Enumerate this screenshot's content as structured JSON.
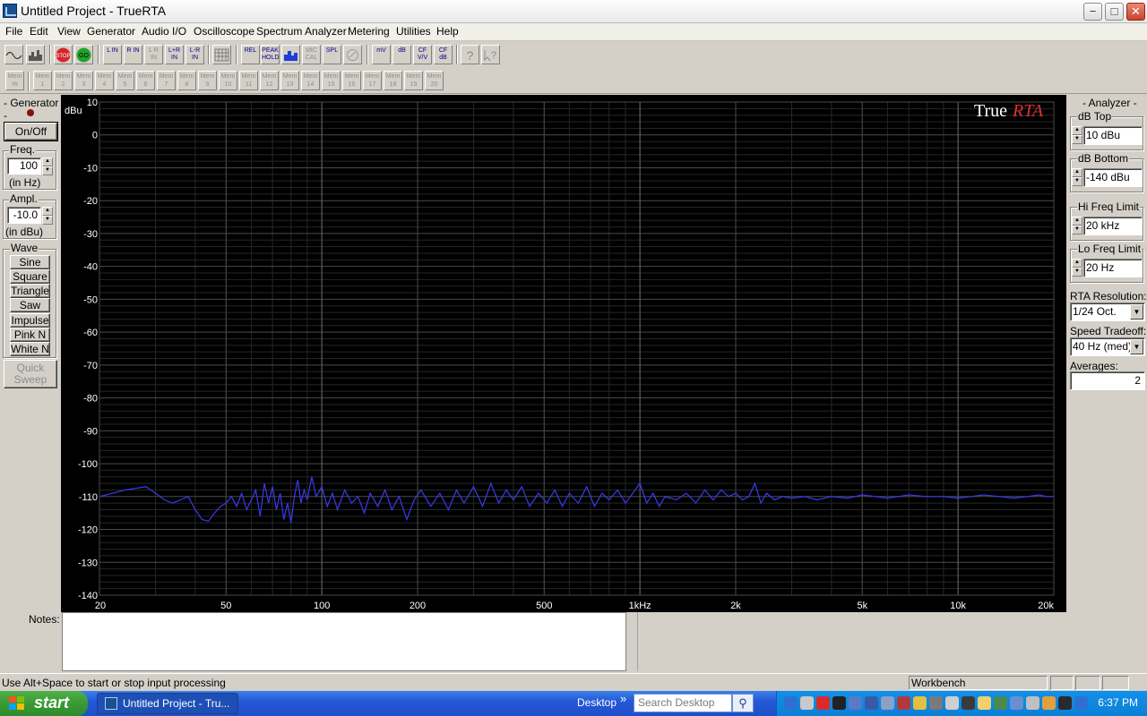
{
  "window": {
    "title": "Untitled Project - TrueRTA",
    "minimize": "−",
    "maximize": "□",
    "close": "✕"
  },
  "menu": [
    "File",
    "Edit",
    "View",
    "Generator",
    "Audio I/O",
    "Oscilloscope",
    "Spectrum Analyzer",
    "Metering",
    "Utilities",
    "Help"
  ],
  "toolbar": {
    "stop": "STOP",
    "go": "GO",
    "l_in": "L IN",
    "r_in": "R IN",
    "lr_in": "L R IN",
    "lplusr_in": "L+R IN",
    "lminusr_in": "L-R IN",
    "rel": "REL",
    "peak_hold": "PEAK HOLD",
    "mic_cal": "MIC CAL",
    "spl": "SPL",
    "mv": "mV",
    "db": "dB",
    "cf_vv": "CF V/V",
    "cf_db": "CF dB"
  },
  "memory": {
    "mem_w": "Mem W",
    "slots": [
      "Mem 1",
      "Mem 2",
      "Mem 3",
      "Mem 4",
      "Mem 5",
      "Mem 6",
      "Mem 7",
      "Mem 8",
      "Mem 9",
      "Mem 10",
      "Mem 11",
      "Mem 12",
      "Mem 13",
      "Mem 14",
      "Mem 15",
      "Mem 16",
      "Mem 17",
      "Mem 18",
      "Mem 19",
      "Mem 20"
    ]
  },
  "generator": {
    "title": "- Generator -",
    "onoff": "On/Off",
    "freq_label": "Freq.",
    "freq_value": "100",
    "freq_unit": "(in Hz)",
    "ampl_label": "Ampl.",
    "ampl_value": "-10.0",
    "ampl_unit": "(in dBu)",
    "wave_label": "Wave",
    "waves": [
      "Sine",
      "Square",
      "Triangle",
      "Saw",
      "Impulse",
      "Pink N",
      "White N"
    ],
    "quick_sweep": "Quick Sweep"
  },
  "analyzer": {
    "title": "- Analyzer -",
    "db_top_label": "dB Top",
    "db_top": "10 dBu",
    "db_bottom_label": "dB Bottom",
    "db_bottom": "-140 dBu",
    "hi_freq_label": "Hi Freq Limit",
    "hi_freq": "20 kHz",
    "lo_freq_label": "Lo Freq Limit",
    "lo_freq": "20 Hz",
    "rta_res_label": "RTA Resolution:",
    "rta_res": "1/24 Oct.",
    "speed_label": "Speed Tradeoff:",
    "speed": "40 Hz (med)",
    "averages_label": "Averages:",
    "averages": "2"
  },
  "notes": {
    "label": "Notes:"
  },
  "status": {
    "hint": "Use Alt+Space to start or stop input processing",
    "workbench": "Workbench"
  },
  "taskbar": {
    "start": "start",
    "task": "Untitled Project - Tru...",
    "desktop": "Desktop",
    "chevron": "»",
    "search_placeholder": "Search Desktop",
    "clock": "6:37 PM"
  },
  "colors": {
    "plot_bg": "#000000",
    "trace": "#3a3af0",
    "grid_major": "#4a4a4a",
    "grid_minor": "#262626",
    "brand_red": "#e03030"
  },
  "chart_data": {
    "type": "line",
    "brand": {
      "true": "True",
      "rta": "RTA"
    },
    "ylabel": "dBu",
    "ylim": [
      -140,
      10
    ],
    "xlim": [
      20,
      20000
    ],
    "x_scale": "log",
    "y_ticks": [
      "10",
      "0",
      "-10",
      "-20",
      "-30",
      "-40",
      "-50",
      "-60",
      "-70",
      "-80",
      "-90",
      "-100",
      "-110",
      "-120",
      "-130",
      "-140"
    ],
    "x_ticks": [
      {
        "v": 20,
        "label": "20"
      },
      {
        "v": 50,
        "label": "50"
      },
      {
        "v": 100,
        "label": "100"
      },
      {
        "v": 200,
        "label": "200"
      },
      {
        "v": 500,
        "label": "500"
      },
      {
        "v": 1000,
        "label": "1kHz"
      },
      {
        "v": 2000,
        "label": "2k"
      },
      {
        "v": 5000,
        "label": "5k"
      },
      {
        "v": 10000,
        "label": "10k"
      },
      {
        "v": 20000,
        "label": "20k"
      }
    ],
    "series": [
      {
        "points": [
          [
            20,
            -110
          ],
          [
            22,
            -109
          ],
          [
            24,
            -108
          ],
          [
            26,
            -107.5
          ],
          [
            28,
            -107
          ],
          [
            30,
            -109
          ],
          [
            32,
            -111
          ],
          [
            34,
            -112
          ],
          [
            36,
            -111
          ],
          [
            38,
            -110
          ],
          [
            40,
            -114
          ],
          [
            42,
            -117
          ],
          [
            44,
            -117.5
          ],
          [
            46,
            -115
          ],
          [
            48,
            -113
          ],
          [
            50,
            -112
          ],
          [
            52,
            -110
          ],
          [
            54,
            -113
          ],
          [
            56,
            -109
          ],
          [
            58,
            -114
          ],
          [
            60,
            -111
          ],
          [
            62,
            -108
          ],
          [
            64,
            -116
          ],
          [
            66,
            -106
          ],
          [
            68,
            -112
          ],
          [
            70,
            -107
          ],
          [
            72,
            -114
          ],
          [
            74,
            -109
          ],
          [
            76,
            -117
          ],
          [
            78,
            -112
          ],
          [
            80,
            -118
          ],
          [
            82,
            -110
          ],
          [
            84,
            -105
          ],
          [
            86,
            -112
          ],
          [
            88,
            -108
          ],
          [
            90,
            -111
          ],
          [
            93,
            -104
          ],
          [
            96,
            -110
          ],
          [
            100,
            -107
          ],
          [
            104,
            -113
          ],
          [
            108,
            -109
          ],
          [
            112,
            -114
          ],
          [
            118,
            -108
          ],
          [
            124,
            -112
          ],
          [
            130,
            -110
          ],
          [
            136,
            -115
          ],
          [
            142,
            -109
          ],
          [
            150,
            -113
          ],
          [
            158,
            -108
          ],
          [
            166,
            -114
          ],
          [
            175,
            -110
          ],
          [
            185,
            -117
          ],
          [
            195,
            -111
          ],
          [
            205,
            -108
          ],
          [
            220,
            -113
          ],
          [
            235,
            -109
          ],
          [
            250,
            -114
          ],
          [
            265,
            -108
          ],
          [
            280,
            -112
          ],
          [
            300,
            -107
          ],
          [
            320,
            -113
          ],
          [
            340,
            -106
          ],
          [
            360,
            -112
          ],
          [
            380,
            -108
          ],
          [
            400,
            -111
          ],
          [
            425,
            -107
          ],
          [
            450,
            -113
          ],
          [
            480,
            -109
          ],
          [
            510,
            -112
          ],
          [
            540,
            -108
          ],
          [
            570,
            -113
          ],
          [
            600,
            -109
          ],
          [
            640,
            -112
          ],
          [
            680,
            -107
          ],
          [
            720,
            -113
          ],
          [
            760,
            -109
          ],
          [
            800,
            -111
          ],
          [
            850,
            -108
          ],
          [
            900,
            -112
          ],
          [
            950,
            -109
          ],
          [
            1000,
            -106
          ],
          [
            1050,
            -112
          ],
          [
            1100,
            -109
          ],
          [
            1150,
            -113
          ],
          [
            1200,
            -110
          ],
          [
            1300,
            -111
          ],
          [
            1400,
            -109
          ],
          [
            1500,
            -112
          ],
          [
            1600,
            -108
          ],
          [
            1700,
            -111
          ],
          [
            1800,
            -108
          ],
          [
            1900,
            -110
          ],
          [
            2000,
            -109
          ],
          [
            2100,
            -111
          ],
          [
            2200,
            -110
          ],
          [
            2300,
            -106
          ],
          [
            2400,
            -112
          ],
          [
            2500,
            -109
          ],
          [
            2650,
            -111
          ],
          [
            2800,
            -110
          ],
          [
            3000,
            -110.5
          ],
          [
            3300,
            -110
          ],
          [
            3600,
            -111
          ],
          [
            4000,
            -110
          ],
          [
            4500,
            -110.5
          ],
          [
            5000,
            -109.5
          ],
          [
            5500,
            -110
          ],
          [
            6000,
            -110.5
          ],
          [
            7000,
            -109.5
          ],
          [
            8000,
            -110
          ],
          [
            9000,
            -110
          ],
          [
            10000,
            -110.5
          ],
          [
            11000,
            -110
          ],
          [
            12000,
            -109.5
          ],
          [
            13500,
            -110
          ],
          [
            15000,
            -110.5
          ],
          [
            16500,
            -110
          ],
          [
            18000,
            -109.5
          ],
          [
            19000,
            -110
          ],
          [
            20000,
            -110
          ]
        ]
      }
    ]
  }
}
